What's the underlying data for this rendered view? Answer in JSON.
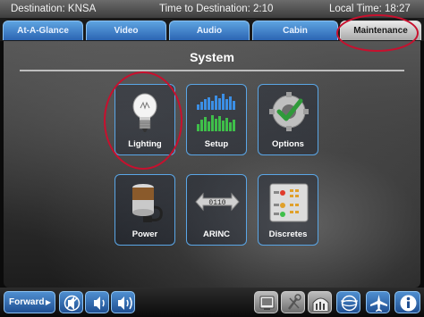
{
  "status": {
    "destination": "Destination: KNSA",
    "time_to_destination": "Time to Destination: 2:10",
    "local_time": "Local Time: 18:27"
  },
  "tabs": [
    {
      "label": "At-A-Glance",
      "active": false
    },
    {
      "label": "Video",
      "active": false
    },
    {
      "label": "Audio",
      "active": false
    },
    {
      "label": "Cabin",
      "active": false
    },
    {
      "label": "Maintenance",
      "active": true
    }
  ],
  "section_title": "System",
  "tiles": [
    {
      "label": "Lighting",
      "icon": "light-bulb-icon"
    },
    {
      "label": "Setup",
      "icon": "bar-graph-icon"
    },
    {
      "label": "Options",
      "icon": "wrench-check-icon"
    },
    {
      "label": "Power",
      "icon": "battery-plug-icon"
    },
    {
      "label": "ARINC",
      "icon": "arinc-bus-icon",
      "bus_text": "0110"
    },
    {
      "label": "Discretes",
      "icon": "discretes-panel-icon"
    }
  ],
  "bottom": {
    "forward_label": "Forward",
    "buttons": [
      {
        "icon": "mute-icon"
      },
      {
        "icon": "volume-down-icon"
      },
      {
        "icon": "volume-up-icon"
      },
      {
        "icon": "monitor-icon"
      },
      {
        "icon": "settings-tools-icon"
      },
      {
        "icon": "cabin-seats-icon"
      },
      {
        "icon": "globe-icon"
      },
      {
        "icon": "airplane-icon"
      },
      {
        "icon": "info-icon"
      }
    ]
  },
  "colors": {
    "accent": "#5aa6e6",
    "tab_blue": "#3a7bc8",
    "highlight_circle": "#c8102e"
  }
}
